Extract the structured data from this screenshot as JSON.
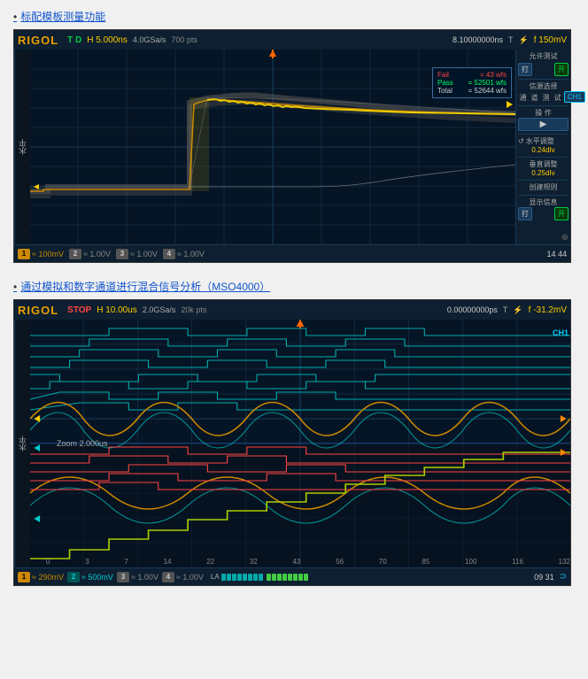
{
  "section1": {
    "link_text": "标配模板测量功能",
    "osc": {
      "logo": "RIGOL",
      "status": "T D",
      "h_param": "H  5.000ns",
      "sample_rate": "4.0GSa/s",
      "mem_depth": "700 pts",
      "trigger_time": "8.10000000ns",
      "trigger_icon": "T",
      "volt_scale": "f  150mV",
      "ylabel": "水平",
      "ch1_label": "1",
      "ch1_scale": "≈ 100mV",
      "ch2_scale": "≈ 1.00V",
      "ch3_scale": "≈ 1.00V",
      "ch4_scale": "≈ 1.00V",
      "time_display": "14 44",
      "measure": {
        "fail_label": "Fail",
        "fail_val": "= 43 wfs",
        "pass_label": "Pass",
        "pass_val": "= 52501 wfs",
        "total_label": "Total",
        "total_val": "= 52644 wfs"
      },
      "right_panel": {
        "label1": "允许测试",
        "btn1a": "打",
        "btn1b": "开",
        "label2": "信源选择",
        "label3": "通",
        "label4": "道",
        "label5": "测",
        "label6": "试",
        "ch_select": "CH1",
        "label_op": "操 作",
        "play_icon": "▶",
        "label_h": "水平调整",
        "h_val": "0.24dIv",
        "label_v": "垂直调整",
        "v_val": "0.25dIv",
        "label_rule": "创建规则",
        "label_info": "显示信息",
        "btn_info_a": "打",
        "btn_info_b": "开"
      }
    }
  },
  "section2": {
    "link_text": "通过模拟和数字通道进行混合信号分析（MSO4000）",
    "osc": {
      "logo": "RIGOL",
      "status": "STOP",
      "h_param": "H  10.00us",
      "sample_rate": "2.0GSa/s",
      "mem_depth": "20k pts",
      "trigger_time": "0.00000000ps",
      "trigger_icon": "T",
      "volt_scale": "f  -31.2mV",
      "ylabel": "水平",
      "ch_right": "CH1",
      "zoom_label": "Zoom 2.000us",
      "ch1_label": "1",
      "ch1_scale": "≈ 290mV",
      "ch2_scale": "≈ 500mV",
      "ch3_scale": "≈ 1.00V",
      "ch4_scale": "≈ 1.00V",
      "time_display": "09 31",
      "la_label": "LA",
      "x_axis": [
        "0",
        "3",
        "7",
        "14",
        "22",
        "32",
        "43",
        "56",
        "70",
        "85",
        "100",
        "116",
        "132"
      ]
    }
  }
}
